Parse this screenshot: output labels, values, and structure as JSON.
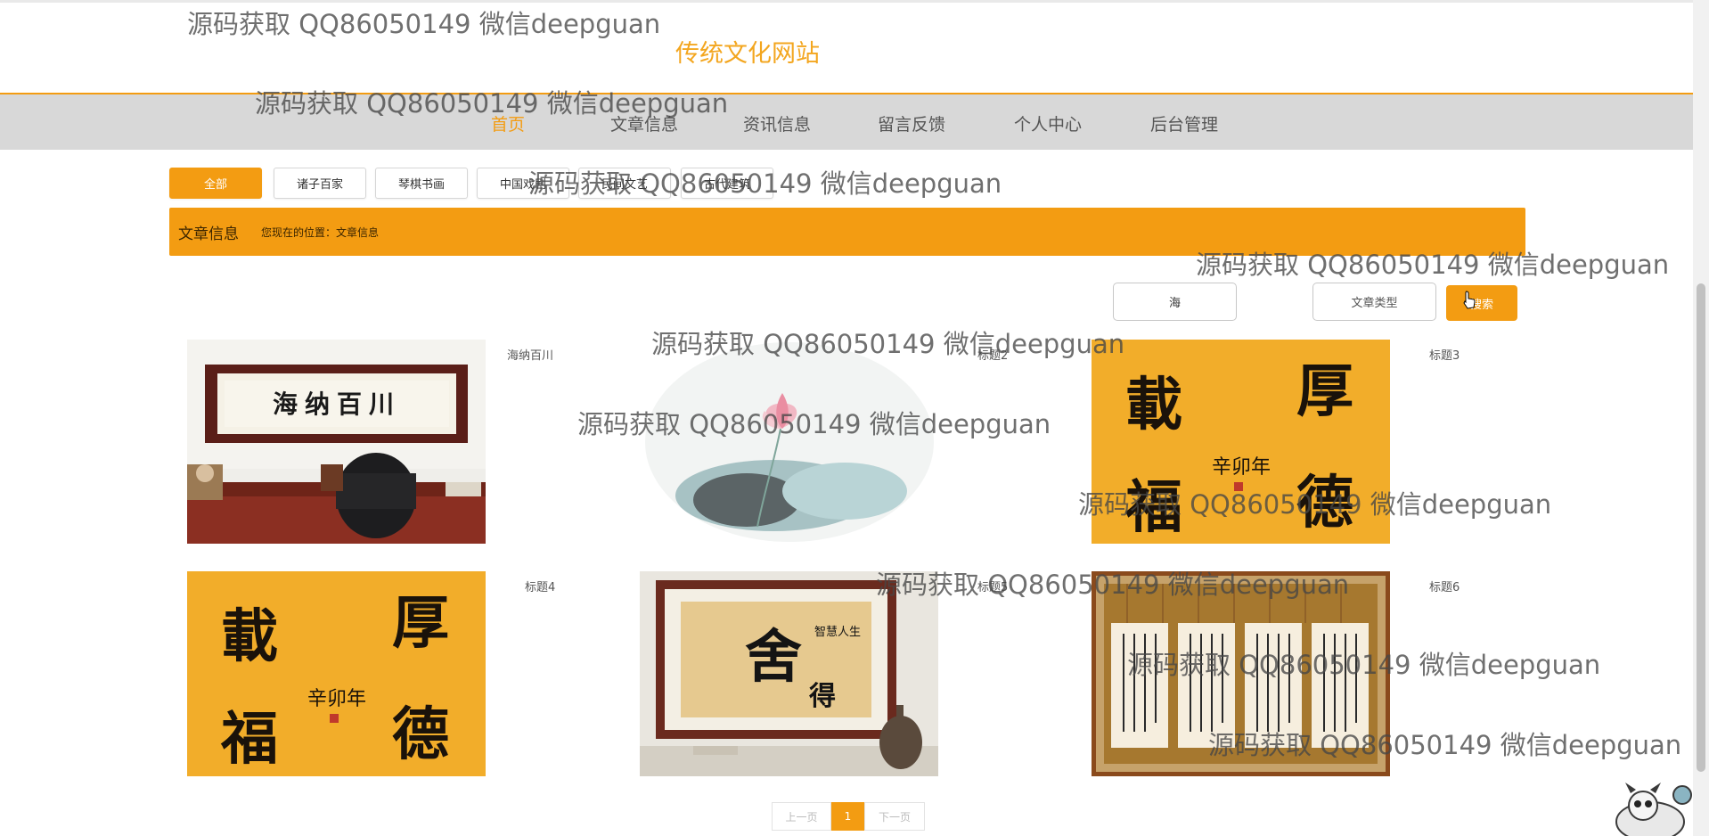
{
  "site": {
    "title": "传统文化网站"
  },
  "nav": {
    "items": [
      {
        "label": "首页",
        "active": true
      },
      {
        "label": "文章信息"
      },
      {
        "label": "资讯信息"
      },
      {
        "label": "留言反馈"
      },
      {
        "label": "个人中心"
      },
      {
        "label": "后台管理"
      }
    ]
  },
  "categories": [
    {
      "label": "全部",
      "active": true
    },
    {
      "label": "诸子百家"
    },
    {
      "label": "琴棋书画"
    },
    {
      "label": "中国戏剧"
    },
    {
      "label": "民间文艺"
    },
    {
      "label": "古代建筑"
    }
  ],
  "breadcrumb": {
    "title": "文章信息",
    "path": "您现在的位置：文章信息"
  },
  "search": {
    "value": "海",
    "type_label": "文章类型",
    "button_label": "搜索"
  },
  "articles": [
    {
      "title": "海纳百川"
    },
    {
      "title": "标题2"
    },
    {
      "title": "标题3"
    },
    {
      "title": "标题4"
    },
    {
      "title": "标题5"
    },
    {
      "title": "标题6"
    }
  ],
  "pagination": {
    "prev_label": "上一页",
    "current": "1",
    "next_label": "下一页"
  },
  "watermark": {
    "text": "源码获取 QQ86050149 微信deepguan"
  },
  "colors": {
    "accent": "#f39c12",
    "nav_background": "#d8d8d8",
    "paper_gold": "#f2ad2a"
  },
  "icons": [
    "mouse-pointer-icon",
    "mascot-icon"
  ]
}
